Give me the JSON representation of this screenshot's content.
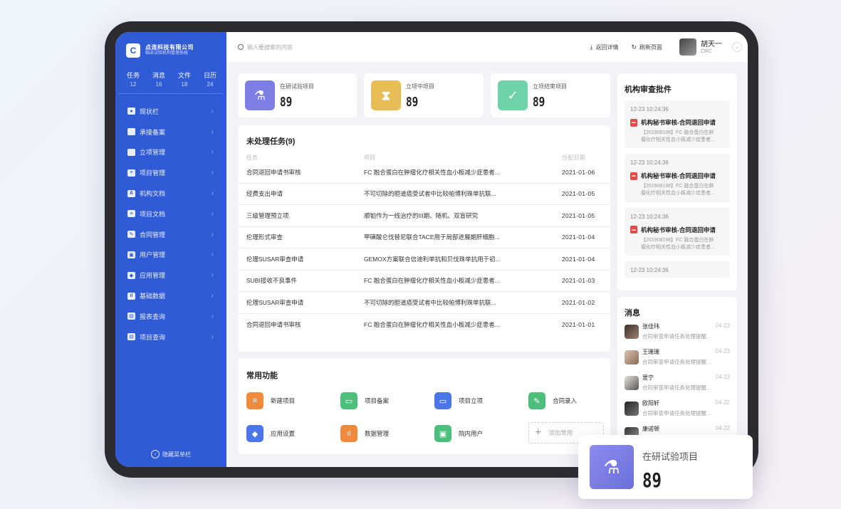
{
  "app": {
    "company": "点连科技有限公司",
    "subtitle": "临床试验机构管理系统"
  },
  "sidebar": {
    "stats": [
      {
        "label": "任务",
        "value": "12"
      },
      {
        "label": "消息",
        "value": "16"
      },
      {
        "label": "文件",
        "value": "18"
      },
      {
        "label": "日历",
        "value": "24"
      }
    ],
    "items": [
      {
        "label": "现状栏",
        "icon": "pie-chart-icon"
      },
      {
        "label": "承接备案",
        "icon": "folder-icon"
      },
      {
        "label": "立项管理",
        "icon": "inbox-icon"
      },
      {
        "label": "项目管理",
        "icon": "stack-icon"
      },
      {
        "label": "机构文档",
        "icon": "document-icon"
      },
      {
        "label": "项目文档",
        "icon": "file-icon"
      },
      {
        "label": "合同管理",
        "icon": "contract-icon"
      },
      {
        "label": "用户管理",
        "icon": "user-icon"
      },
      {
        "label": "应用管理",
        "icon": "cube-icon"
      },
      {
        "label": "基础数据",
        "icon": "bar-chart-icon"
      },
      {
        "label": "报表查询",
        "icon": "report-icon"
      },
      {
        "label": "项目查询",
        "icon": "search-doc-icon"
      }
    ],
    "collapse_label": "隐藏菜单栏"
  },
  "topbar": {
    "search_placeholder": "输入要搜索的内容",
    "back_label": "返回详情",
    "refresh_label": "刷新页面",
    "user_name": "胡天一",
    "user_role": "CRC"
  },
  "kpis": [
    {
      "label": "在研试验项目",
      "value": "89",
      "color": "#7d7fe6",
      "icon": "flask-icon"
    },
    {
      "label": "立项中项目",
      "value": "89",
      "color": "#e6be55",
      "icon": "hourglass-icon"
    },
    {
      "label": "立项结束项目",
      "value": "89",
      "color": "#6fd3a9",
      "icon": "doc-check-icon"
    }
  ],
  "tasks": {
    "title": "未处理任务(9)",
    "headers": [
      "任务",
      "项目",
      "分配日期"
    ],
    "rows": [
      [
        "合同退回申请书审核",
        "FC 融合蛋白在肿瘤化疗相关性血小板减少症患者...",
        "2021-01-06"
      ],
      [
        "经费支出申请",
        "不可切除的胆道癌受试者中比较帕博利珠单抗联...",
        "2021-01-05"
      ],
      [
        "三级管理预立项",
        "顺铂作为一线治疗的III期、随机、双盲研究",
        "2021-01-05"
      ],
      [
        "伦理形式审查",
        "甲磺酸仑伐替尼联合TACE用于局部进展期肝细胞...",
        "2021-01-04"
      ],
      [
        "伦理SUSAR审查申请",
        "GEMOX方案联合信迪利单抗和贝伐珠单抗用于初...",
        "2021-01-04"
      ],
      [
        "SUBI接收不良事件",
        "FC 融合蛋白在肿瘤化疗相关性血小板减少症患者...",
        "2021-01-03"
      ],
      [
        "伦理SUSAR审查申请",
        "不可切除的胆道癌受试者中比较帕博利珠单抗联...",
        "2021-01-02"
      ],
      [
        "合同退回申请书审核",
        "FC 融合蛋白在肿瘤化疗相关性血小板减少症患者...",
        "2021-01-01"
      ]
    ]
  },
  "functions": {
    "title": "常用功能",
    "items": [
      {
        "label": "新建项目",
        "color": "#ef8a3c",
        "icon": "stack-icon"
      },
      {
        "label": "项目备案",
        "color": "#4cbf7c",
        "icon": "folder-icon"
      },
      {
        "label": "项目立项",
        "color": "#4a76e8",
        "icon": "inbox-icon"
      },
      {
        "label": "合同录入",
        "color": "#4cbf7c",
        "icon": "contract-icon"
      },
      {
        "label": "应用设置",
        "color": "#4a76e8",
        "icon": "cube-icon"
      },
      {
        "label": "数据管理",
        "color": "#ef8a3c",
        "icon": "bar-chart-icon"
      },
      {
        "label": "院内用户",
        "color": "#4cbf7c",
        "icon": "user-icon"
      }
    ],
    "add_label": "添加常用"
  },
  "audits": {
    "title": "机构审查批件",
    "items": [
      {
        "time": "12-23 10:24:36",
        "title": "机构秘书审核-合同退回申请",
        "body1": "【201908198】FC 融合蛋白在肿",
        "body2": "瘤化疗相关性血小板减少症患者..."
      },
      {
        "time": "12-23 10:24:36",
        "title": "机构秘书审核-合同退回申请",
        "body1": "【201908198】FC 融合蛋白在肿",
        "body2": "瘤化疗相关性血小板减少症患者..."
      },
      {
        "time": "12-23 10:24:36",
        "title": "机构秘书审核-合同退回申请",
        "body1": "【201908198】FC 融合蛋白在肿",
        "body2": "瘤化疗相关性血小板减少症患者..."
      },
      {
        "time": "12-23 10:24:36"
      }
    ]
  },
  "messages": {
    "title": "消息",
    "items": [
      {
        "name": "张佳玮",
        "date": "04-23",
        "text": "合同审查申请任务处理提醒..."
      },
      {
        "name": "王珊珊",
        "date": "04-23",
        "text": "合同审查申请任务处理提醒..."
      },
      {
        "name": "里宁",
        "date": "04-23",
        "text": "合同审查申请任务处理提醒..."
      },
      {
        "name": "欧阳轩",
        "date": "04-22",
        "text": "合同审查申请任务处理提醒..."
      },
      {
        "name": "康诺顿",
        "date": "04-22",
        "text": ""
      }
    ]
  },
  "floating_card": {
    "label": "在研试验项目",
    "value": "89"
  }
}
